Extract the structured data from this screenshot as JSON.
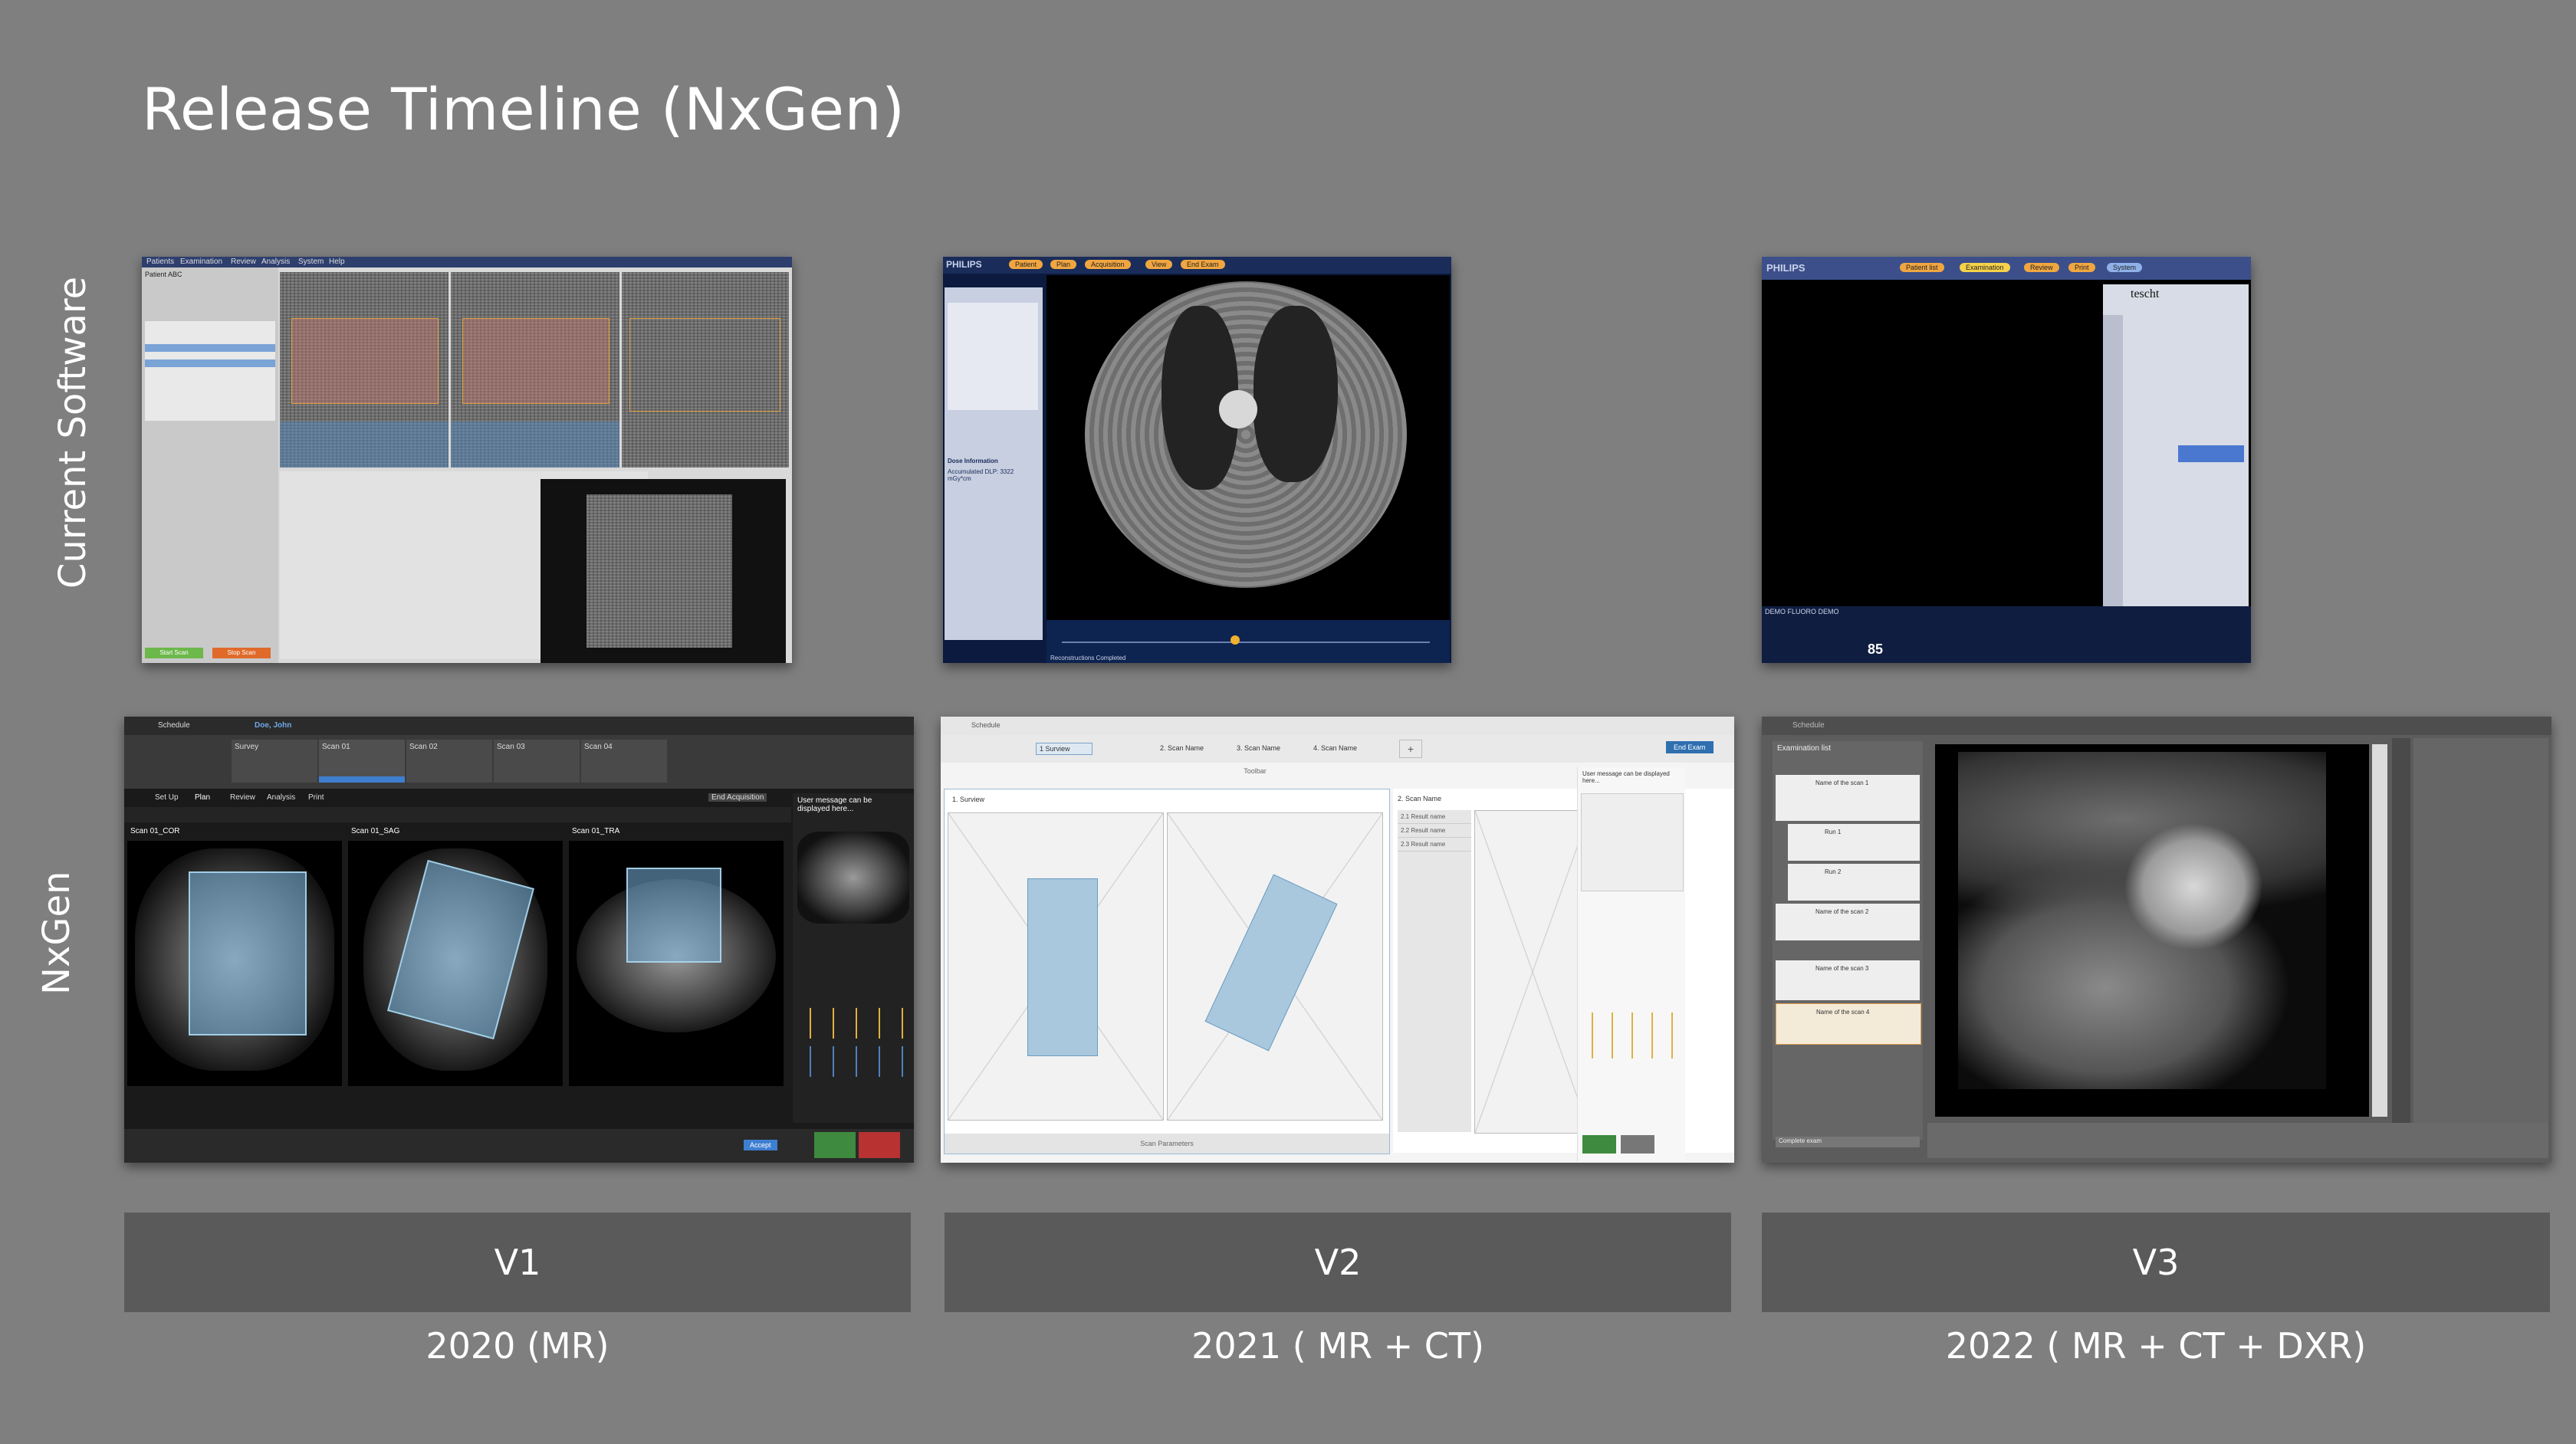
{
  "title": "Release Timeline (NxGen)",
  "rows": {
    "current": "Current Software",
    "nxgen": "NxGen"
  },
  "screens": {
    "current_mr": {
      "tabs": [
        "Patients",
        "Examination",
        "Review",
        "Analysis",
        "System",
        "Help"
      ],
      "patient": "Patient ABC",
      "start": "Start Scan",
      "stop": "Stop Scan"
    },
    "current_ct": {
      "brand": "PHILIPS",
      "tabs": [
        "Patient",
        "Plan",
        "Acquisition",
        "View",
        "End Exam"
      ],
      "dose_title": "Dose Information",
      "dose": "Accumulated DLP: 3322 mGy*cm",
      "status": "Reconstructions Completed"
    },
    "current_dxr": {
      "brand": "PHILIPS",
      "tabs": [
        "Patient list",
        "Examination",
        "Review",
        "Print",
        "System"
      ],
      "patient": "tescht",
      "footer": "DEMO   FLUORO DEMO",
      "kv": "85"
    },
    "nxgen_v1": {
      "app": "Schedule",
      "patient": "Doe, John",
      "scans": [
        "Survey",
        "Scan 01",
        "Scan 02",
        "Scan 03",
        "Scan 04"
      ],
      "tabs": [
        "Set Up",
        "Plan",
        "Review",
        "Analysis",
        "Print"
      ],
      "views": [
        "Scan 01_COR",
        "Scan 01_SAG",
        "Scan 01_TRA"
      ],
      "end": "End Acquisition",
      "accept": "Accept",
      "message": "User message can be displayed here..."
    },
    "nxgen_v2": {
      "app": "Schedule",
      "steps": [
        "1 Surview",
        "2. Scan Name",
        "3. Scan Name",
        "4. Scan Name"
      ],
      "toolbar": "Toolbar",
      "view1": "1. Surview",
      "view2": "2. Scan Name",
      "results": [
        "2.1 Result name",
        "2.2 Result name",
        "2.3 Result name"
      ],
      "params": "Scan Parameters",
      "end": "End Exam",
      "message": "User message can be displayed here..."
    },
    "nxgen_v3": {
      "app": "Schedule",
      "list_title": "Examination list",
      "items": [
        "Name of the scan 1",
        "Run 1",
        "Run 2",
        "Name of the scan 2",
        "Name of the scan 3",
        "Name of the scan 4"
      ],
      "complete": "Complete exam"
    }
  },
  "versions": [
    {
      "label": "V1",
      "year": "2020 (MR)"
    },
    {
      "label": "V2",
      "year": "2021 ( MR + CT)"
    },
    {
      "label": "V3",
      "year": "2022 ( MR + CT + DXR)"
    }
  ]
}
